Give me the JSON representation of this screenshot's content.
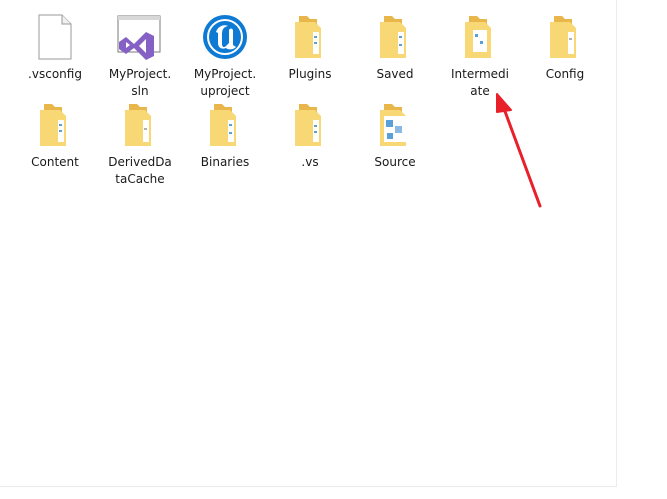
{
  "files": [
    {
      "label": ".vsconfig",
      "icon": "blank-file-icon"
    },
    {
      "label": "MyProject.\nsln",
      "icon": "visual-studio-solution-icon"
    },
    {
      "label": "MyProject.\nuproject",
      "icon": "unreal-engine-icon"
    },
    {
      "label": "Plugins",
      "icon": "folder-icon"
    },
    {
      "label": "Saved",
      "icon": "folder-icon"
    },
    {
      "label": "Intermedi\nate",
      "icon": "folder-icon"
    },
    {
      "label": "Config",
      "icon": "folder-icon"
    },
    {
      "label": "Content",
      "icon": "folder-icon"
    },
    {
      "label": "DerivedDa\ntaCache",
      "icon": "folder-icon"
    },
    {
      "label": "Binaries",
      "icon": "folder-icon"
    },
    {
      "label": ".vs",
      "icon": "folder-icon"
    },
    {
      "label": "Source",
      "icon": "source-folder-icon"
    }
  ],
  "colors": {
    "folder_back": "#e8b64a",
    "folder_front": "#f8d775",
    "arrow": "#e8202a",
    "vs_purple": "#8661c5",
    "ue_blue": "#0e7ad3"
  }
}
